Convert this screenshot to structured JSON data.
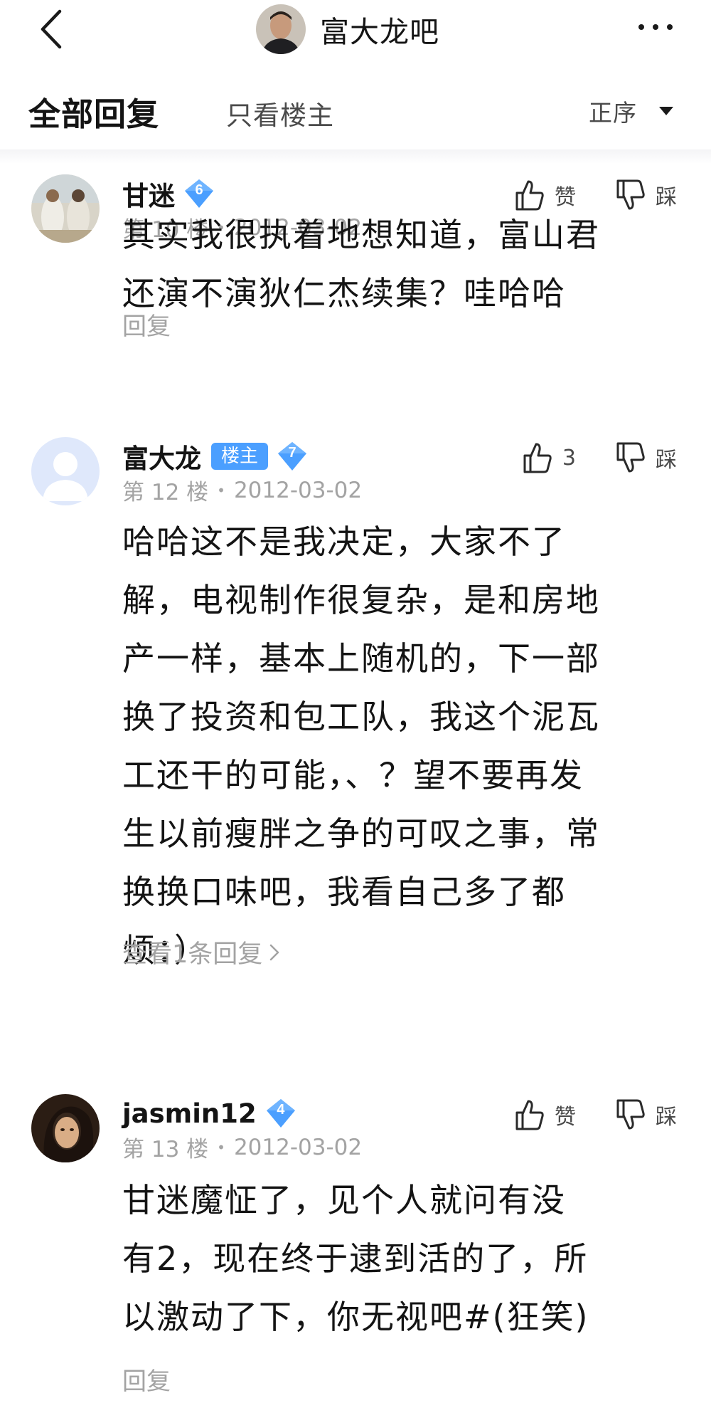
{
  "header": {
    "forum_name": "富大龙吧",
    "back_icon": "chevron-left-icon",
    "more_icon": "more-dots-icon"
  },
  "tabs": {
    "all_replies": "全部回复",
    "only_op": "只看楼主",
    "sort_label": "正序"
  },
  "posts": [
    {
      "username": "甘迷",
      "level": "6",
      "floor": "第 10 楼",
      "date": "2012-03-02",
      "like_label": "赞",
      "dislike_label": "踩",
      "content_lines": [
        "其实我很执着地想知道，富山君",
        "还演不演狄仁杰续集？哇哈哈"
      ],
      "reply_label": "回复"
    },
    {
      "username": "富大龙",
      "op_badge": "楼主",
      "level": "7",
      "floor": "第 12 楼",
      "date": "2012-03-02",
      "like_label": "3",
      "dislike_label": "踩",
      "content_lines": [
        "哈哈这不是我决定，大家不了",
        "解，电视制作很复杂，是和房地",
        "产一样，基本上随机的，下一部",
        "换了投资和包工队，我这个泥瓦",
        "工还干的可能，、？望不要再发",
        "生以前瘦胖之争的可叹之事，常",
        "换换口味吧，我看自己多了都",
        "烦：）"
      ],
      "view_replies_label": "查看1条回复"
    },
    {
      "username": "jasmin12",
      "level": "4",
      "floor": "第 13 楼",
      "date": "2012-03-02",
      "like_label": "赞",
      "dislike_label": "踩",
      "content_lines": [
        "甘迷魔怔了，见个人就问有没",
        "有2，现在终于逮到活的了，所",
        "以激动了下，你无视吧#(狂笑)"
      ],
      "reply_label": "回复"
    }
  ],
  "colors": {
    "badge_blue": "#4b9fff",
    "level_blue": "#4b9fff",
    "meta_gray": "#a3a3a3",
    "text_dark": "#141414"
  }
}
